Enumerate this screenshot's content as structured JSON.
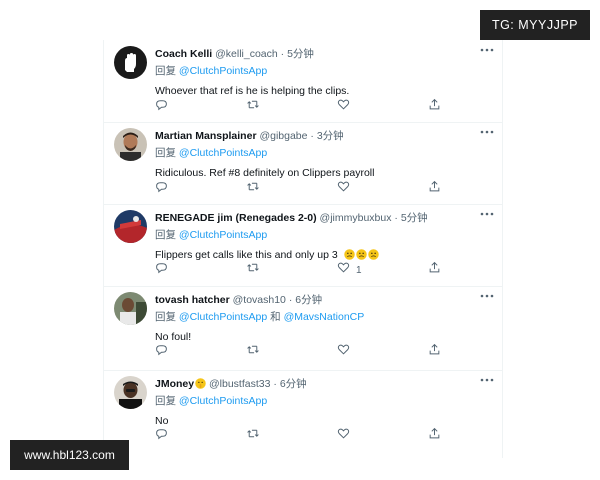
{
  "overlays": {
    "top_right": "TG: MYYJJPP",
    "bottom_left": "www.hbl123.com"
  },
  "colors": {
    "mention": "#1d9bf0",
    "secondary_text": "#536471",
    "primary_text": "#0f1419",
    "divider": "#eff3f4",
    "overlay_bg": "#222222"
  },
  "labels": {
    "reply_prefix": "回复",
    "and": "和",
    "separator": "·"
  },
  "icons": [
    "more-icon",
    "reply-icon",
    "retweet-icon",
    "like-icon",
    "share-icon",
    "worried-face-emoji",
    "shushing-face-emoji"
  ],
  "tweets": [
    {
      "name": "Coach Kelli",
      "handle": "@kelli_coach",
      "time": "5分钟",
      "reply_to": [
        "@ClutchPointsApp"
      ],
      "text": "Whoever that ref is he is helping the clips.",
      "likes": ""
    },
    {
      "name": "Martian Mansplainer",
      "handle": "@gibgabe",
      "time": "3分钟",
      "reply_to": [
        "@ClutchPointsApp"
      ],
      "text": "Ridiculous. Ref #8 definitely on Clippers payroll",
      "likes": ""
    },
    {
      "name": "RENEGADE jim (Renegades 2-0)",
      "handle": "@jimmybuxbux",
      "time": "5分钟",
      "reply_to": [
        "@ClutchPointsApp"
      ],
      "text": "Flippers get calls like this and only up 3",
      "likes": "1"
    },
    {
      "name": "tovash hatcher",
      "handle": "@tovash10",
      "time": "6分钟",
      "reply_to": [
        "@ClutchPointsApp",
        "@MavsNationCP"
      ],
      "text": "No foul!",
      "likes": ""
    },
    {
      "name": "JMoney",
      "handle": "@lbustfast33",
      "time": "6分钟",
      "reply_to": [
        "@ClutchPointsApp"
      ],
      "text": "No",
      "likes": ""
    }
  ]
}
